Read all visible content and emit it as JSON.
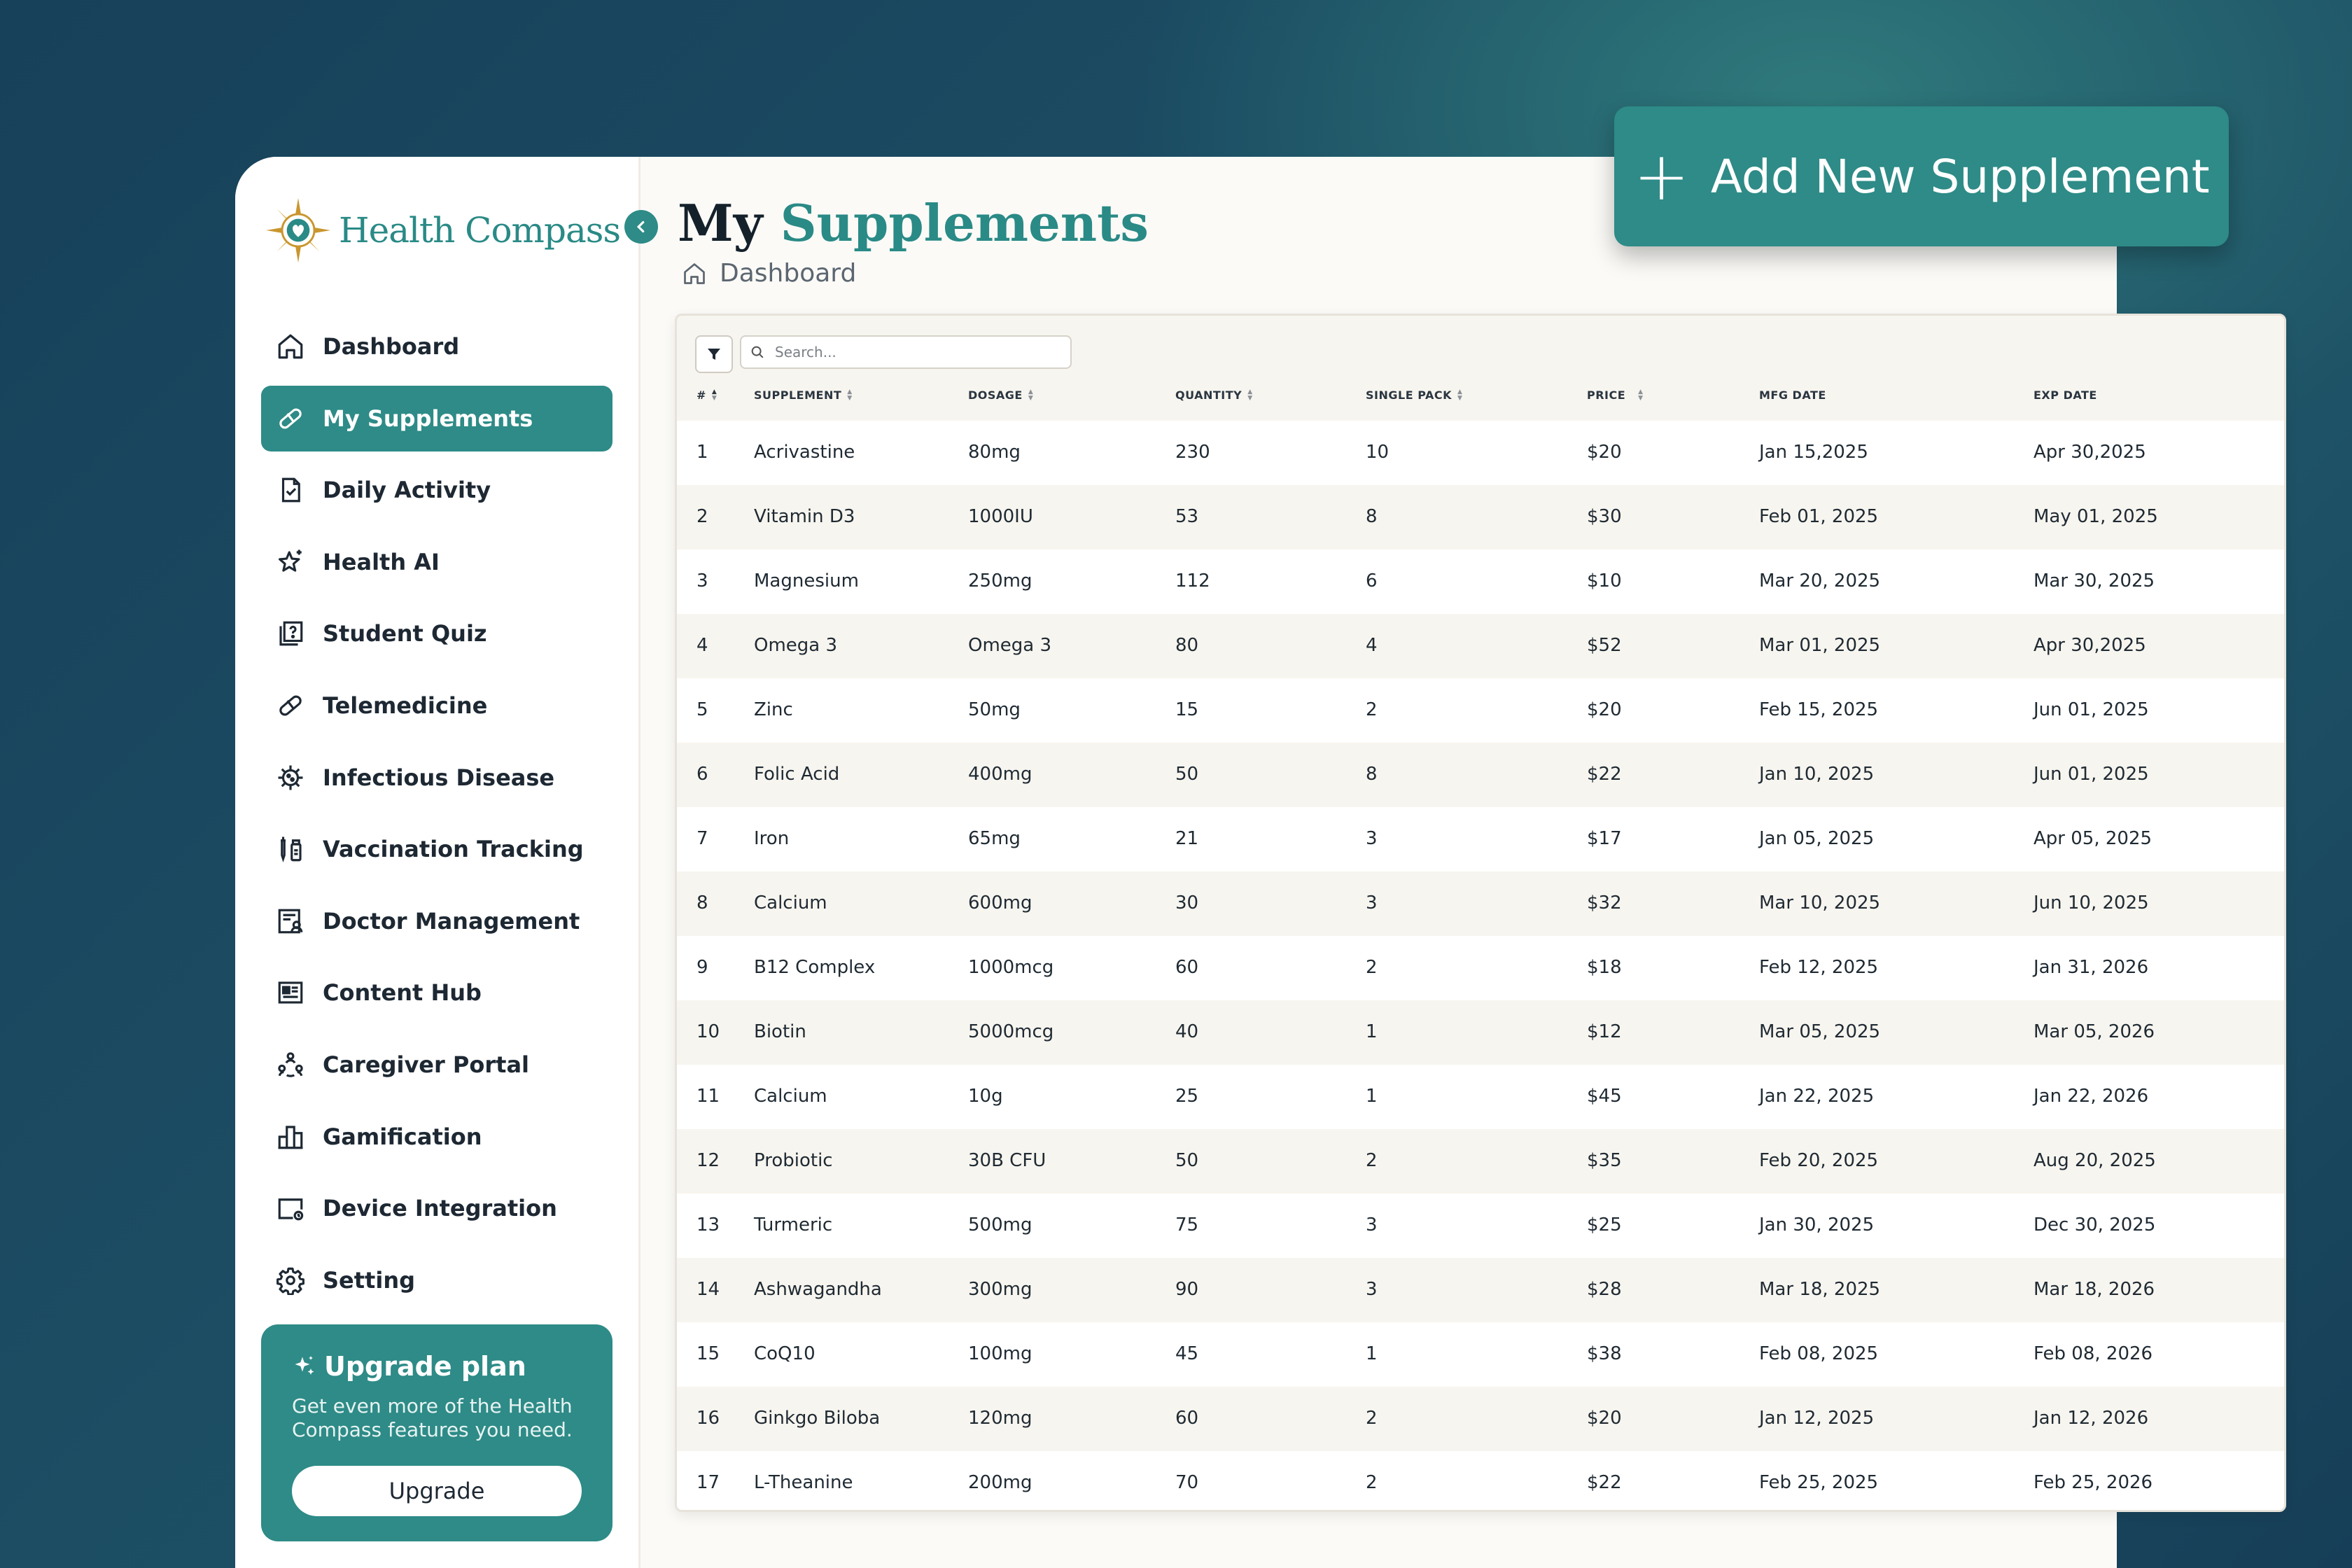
{
  "app": {
    "logo_text": "Health Compass",
    "page_title_part1": "My",
    "page_title_part2": "Supplements",
    "breadcrumb": "Dashboard",
    "add_button_label": "Add New Supplement",
    "accent_color": "#2e8b87"
  },
  "sidebar": {
    "items": [
      {
        "label": "Dashboard",
        "icon": "home-icon"
      },
      {
        "label": "My Supplements",
        "icon": "pill-icon",
        "active": true
      },
      {
        "label": "Daily Activity",
        "icon": "clipboard-check-icon"
      },
      {
        "label": "Health AI",
        "icon": "sparkle-star-icon"
      },
      {
        "label": "Student Quiz",
        "icon": "quiz-icon"
      },
      {
        "label": "Telemedicine",
        "icon": "capsule-icon"
      },
      {
        "label": "Infectious Disease",
        "icon": "virus-icon"
      },
      {
        "label": "Vaccination Tracking",
        "icon": "syringe-icon"
      },
      {
        "label": "Doctor Management",
        "icon": "doctor-list-icon"
      },
      {
        "label": "Content Hub",
        "icon": "newspaper-icon"
      },
      {
        "label": "Caregiver Portal",
        "icon": "caregiver-icon"
      },
      {
        "label": "Gamification",
        "icon": "leaderboard-icon"
      },
      {
        "label": "Device Integration",
        "icon": "device-icon"
      },
      {
        "label": "Setting",
        "icon": "gear-icon"
      }
    ],
    "upgrade": {
      "title": "Upgrade plan",
      "description": "Get even more of the Health Compass features you need.",
      "button": "Upgrade"
    }
  },
  "table": {
    "search_placeholder": "Search...",
    "columns": [
      "#",
      "SUPPLEMENT",
      "DOSAGE",
      "QUANTITY",
      "SINGLE PACK",
      "PRICE",
      "MFG DATE",
      "EXP DATE"
    ],
    "rows": [
      [
        "1",
        "Acrivastine",
        "80mg",
        "230",
        "10",
        "$20",
        "Jan 15,2025",
        "Apr 30,2025"
      ],
      [
        "2",
        "Vitamin D3",
        "1000IU",
        "53",
        "8",
        "$30",
        "Feb 01, 2025",
        "May 01, 2025"
      ],
      [
        "3",
        "Magnesium",
        "250mg",
        "112",
        "6",
        "$10",
        "Mar 20, 2025",
        "Mar 30, 2025"
      ],
      [
        "4",
        "Omega 3",
        "Omega 3",
        "80",
        "4",
        "$52",
        "Mar 01, 2025",
        "Apr 30,2025"
      ],
      [
        "5",
        "Zinc",
        "50mg",
        "15",
        "2",
        "$20",
        "Feb 15, 2025",
        "Jun 01, 2025"
      ],
      [
        "6",
        "Folic Acid",
        "400mg",
        "50",
        "8",
        "$22",
        "Jan 10, 2025",
        "Jun 01, 2025"
      ],
      [
        "7",
        "Iron",
        "65mg",
        "21",
        "3",
        "$17",
        "Jan 05, 2025",
        "Apr 05, 2025"
      ],
      [
        "8",
        "Calcium",
        "600mg",
        "30",
        "3",
        "$32",
        "Mar 10, 2025",
        "Jun 10, 2025"
      ],
      [
        "9",
        "B12 Complex",
        "1000mcg",
        "60",
        "2",
        "$18",
        "Feb 12, 2025",
        "Jan 31, 2026"
      ],
      [
        "10",
        "Biotin",
        "5000mcg",
        "40",
        "1",
        "$12",
        "Mar 05, 2025",
        "Mar 05, 2026"
      ],
      [
        "11",
        "Calcium",
        "10g",
        "25",
        "1",
        "$45",
        "Jan 22, 2025",
        "Jan 22, 2026"
      ],
      [
        "12",
        "Probiotic",
        "30B CFU",
        "50",
        "2",
        "$35",
        "Feb 20, 2025",
        "Aug 20, 2025"
      ],
      [
        "13",
        "Turmeric",
        "500mg",
        "75",
        "3",
        "$25",
        "Jan 30, 2025",
        "Dec 30, 2025"
      ],
      [
        "14",
        "Ashwagandha",
        "300mg",
        "90",
        "3",
        "$28",
        "Mar 18, 2025",
        "Mar 18, 2026"
      ],
      [
        "15",
        "CoQ10",
        "100mg",
        "45",
        "1",
        "$38",
        "Feb 08, 2025",
        "Feb 08, 2026"
      ],
      [
        "16",
        "Ginkgo Biloba",
        "120mg",
        "60",
        "2",
        "$20",
        "Jan 12, 2025",
        "Jan 12, 2026"
      ],
      [
        "17",
        "L-Theanine",
        "200mg",
        "70",
        "2",
        "$22",
        "Feb 25, 2025",
        "Feb 25, 2026"
      ]
    ]
  }
}
